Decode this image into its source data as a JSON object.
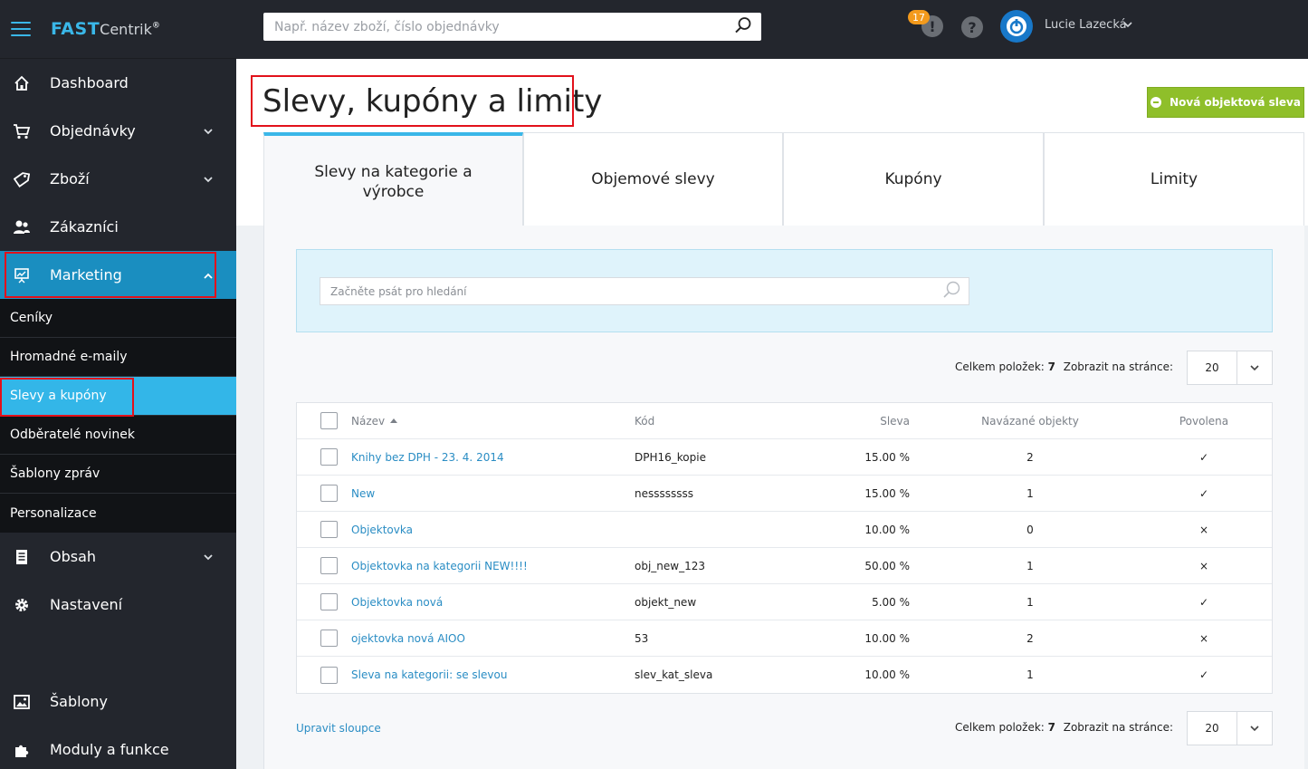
{
  "brand": {
    "name_bold": "FAST",
    "name_thin": "Centrik",
    "reg": "®"
  },
  "topbar": {
    "search_placeholder": "Např. název zboží, číslo objednávky",
    "notifications_count": "17",
    "notif_symbol": "!",
    "help_symbol": "?",
    "user_name": "Lucie Lazecká"
  },
  "sidebar": {
    "items": [
      {
        "label": "Dashboard"
      },
      {
        "label": "Objednávky"
      },
      {
        "label": "Zboží"
      },
      {
        "label": "Zákazníci"
      },
      {
        "label": "Marketing"
      },
      {
        "label": "Obsah"
      },
      {
        "label": "Nastavení"
      },
      {
        "label": "Šablony"
      },
      {
        "label": "Moduly a funkce"
      }
    ],
    "marketing_sub": [
      {
        "label": "Ceníky"
      },
      {
        "label": "Hromadné e-maily"
      },
      {
        "label": "Slevy a kupóny"
      },
      {
        "label": "Odběratelé novinek"
      },
      {
        "label": "Šablony zpráv"
      },
      {
        "label": "Personalizace"
      }
    ]
  },
  "page": {
    "title": "Slevy, kupóny a limity",
    "new_button": "Nová objektová sleva",
    "tabs": [
      {
        "label": "Slevy na kategorie a výrobce"
      },
      {
        "label": "Objemové slevy"
      },
      {
        "label": "Kupóny"
      },
      {
        "label": "Limity"
      }
    ],
    "filter_placeholder": "Začněte psát pro hledání",
    "pager": {
      "total_label": "Celkem položek:",
      "total_value": "7",
      "per_page_label": "Zobrazit na stránce:",
      "per_page_value": "20"
    },
    "edit_columns": "Upravit sloupce"
  },
  "table": {
    "headers": {
      "name": "Název",
      "code": "Kód",
      "discount": "Sleva",
      "linked": "Navázané objekty",
      "enabled": "Povolena"
    },
    "rows": [
      {
        "name": "Knihy bez DPH - 23. 4. 2014",
        "code": "DPH16_kopie",
        "discount": "15.00 %",
        "linked": "2",
        "enabled": "✓"
      },
      {
        "name": "New",
        "code": "nessssssss",
        "discount": "15.00 %",
        "linked": "1",
        "enabled": "✓"
      },
      {
        "name": "Objektovka",
        "code": "",
        "discount": "10.00 %",
        "linked": "0",
        "enabled": "×"
      },
      {
        "name": "Objektovka na kategorii NEW!!!!",
        "code": "obj_new_123",
        "discount": "50.00 %",
        "linked": "1",
        "enabled": "×"
      },
      {
        "name": "Objektovka nová",
        "code": "objekt_new",
        "discount": "5.00 %",
        "linked": "1",
        "enabled": "✓"
      },
      {
        "name": "ojektovka nová AIOO",
        "code": "53",
        "discount": "10.00 %",
        "linked": "2",
        "enabled": "×"
      },
      {
        "name": "Sleva na kategorii: se slevou",
        "code": "slev_kat_sleva",
        "discount": "10.00 %",
        "linked": "1",
        "enabled": "✓"
      }
    ]
  },
  "colors": {
    "accent": "#3ab7e8",
    "sidebar_bg": "#23262d",
    "active_nav": "#1a8ec0",
    "active_sub": "#33b6e8",
    "primary_button": "#8fbf2a",
    "highlight": "#e2111b"
  }
}
